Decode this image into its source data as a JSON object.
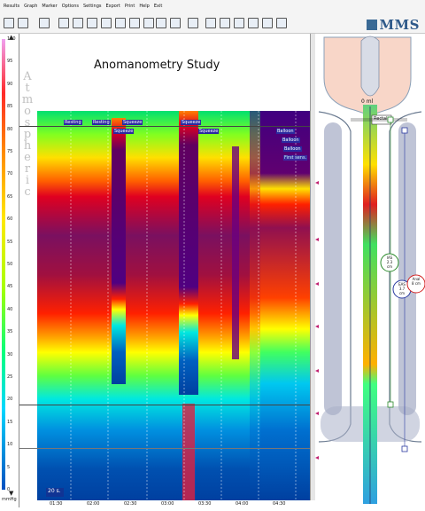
{
  "menu": [
    "Results",
    "Graph",
    "Marker",
    "Options",
    "Settings",
    "Export",
    "Print",
    "Help",
    "Exit"
  ],
  "brand": "MMS",
  "study_title": "Anomanometry Study",
  "scale_ticks": [
    "100",
    "95",
    "90",
    "85",
    "80",
    "75",
    "70",
    "65",
    "60",
    "55",
    "50",
    "45",
    "40",
    "35",
    "30",
    "25",
    "20",
    "15",
    "10",
    "5",
    "0"
  ],
  "scale_unit": "mmHg",
  "atmospheric_letters": [
    "A",
    "t",
    "m",
    "o",
    "s",
    "p",
    "h",
    "e",
    "r",
    "i",
    "c"
  ],
  "marker_labels": [
    "Resting",
    "Resting",
    "Squeeze",
    "Squeeze",
    "Squeeze",
    "Squeeze",
    "Balloon",
    "Balloon",
    "Balloon",
    "First sens."
  ],
  "x_ticks": [
    "01:30",
    "02:00",
    "02:30",
    "03:00",
    "03:30",
    "04:00",
    "04:30"
  ],
  "time_window": "20 s.",
  "diagram": {
    "volume": "0 ml",
    "rectal_label": "Rectal",
    "ias_label": "IAS",
    "ias_value": "2.3 cm",
    "eas_label": "EAS",
    "eas_value": "3.7 cm",
    "anal_label": "Anal",
    "anal_value": "8 cm"
  }
}
